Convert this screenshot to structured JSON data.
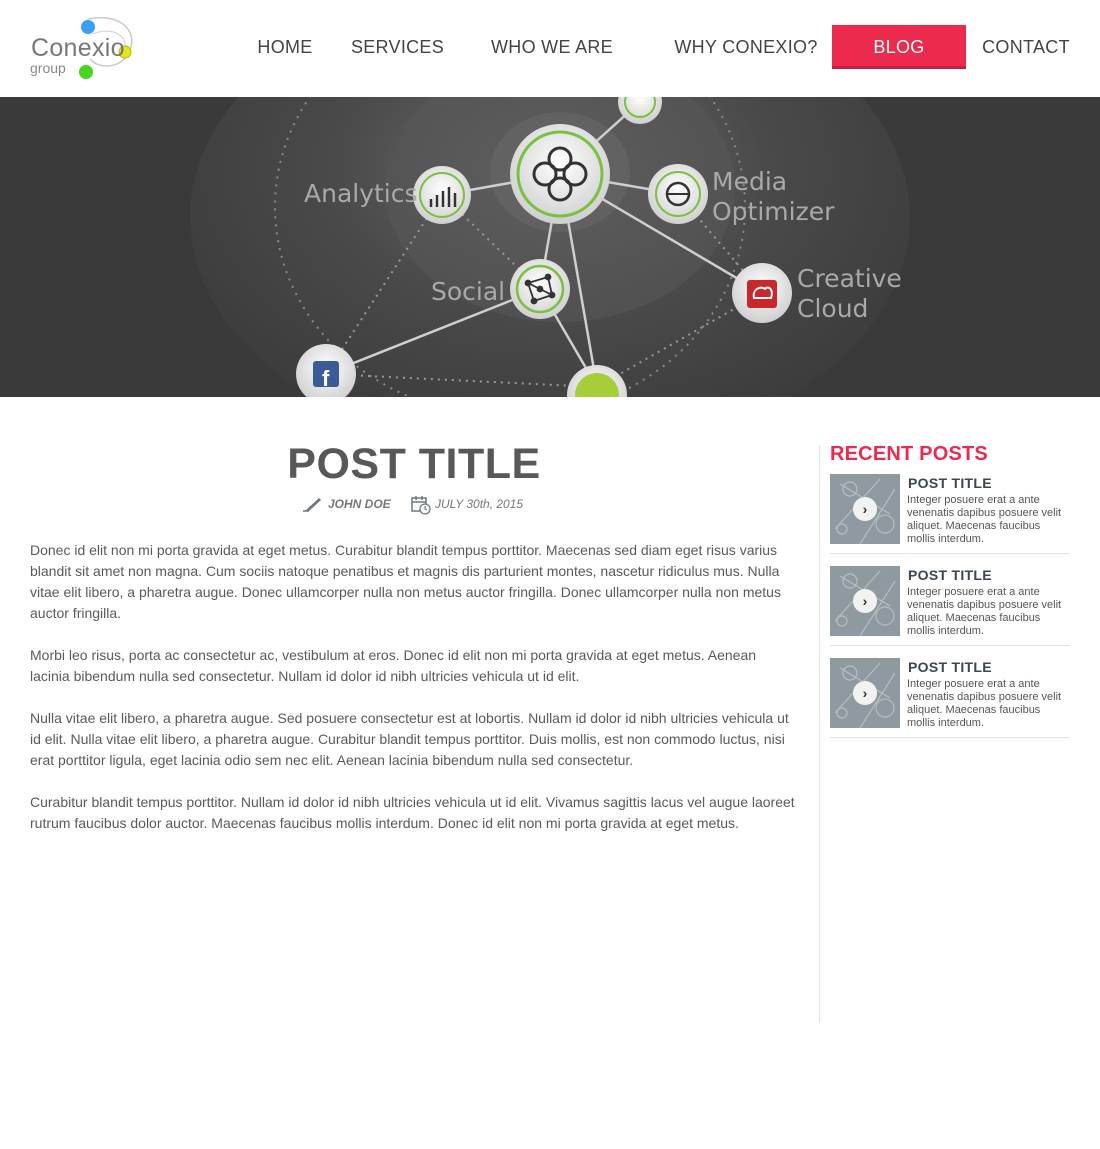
{
  "brand": {
    "name": "Conexio",
    "sub": "group"
  },
  "nav": {
    "items": [
      {
        "label": "HOME"
      },
      {
        "label": "SERVICES"
      },
      {
        "label": "WHO WE ARE"
      },
      {
        "label": "WHY CONEXIO?"
      },
      {
        "label": "BLOG",
        "active": true
      },
      {
        "label": "CONTACT"
      }
    ]
  },
  "hero": {
    "labels": {
      "analytics": "Analytics",
      "media1": "Media",
      "media2": "Optimizer",
      "social": "Social",
      "creative1": "Creative",
      "creative2": "Cloud"
    }
  },
  "post": {
    "title": "POST TITLE",
    "author": "JOHN DOE",
    "date": "JULY 30th, 2015",
    "paragraphs": [
      "Donec id elit non mi porta gravida at eget metus. Curabitur blandit tempus porttitor. Maecenas sed diam eget risus varius blandit sit amet non magna. Cum sociis natoque penatibus et magnis dis parturient montes, nascetur ridiculus mus. Nulla vitae elit libero, a pharetra augue. Donec ullamcorper nulla non metus auctor fringilla. Donec ullamcorper nulla non metus auctor fringilla.",
      "Morbi leo risus, porta ac consectetur ac, vestibulum at eros. Donec id elit non mi porta gravida at eget metus. Aenean lacinia bibendum nulla sed consectetur. Nullam id dolor id nibh ultricies vehicula ut id elit.",
      "Nulla vitae elit libero, a pharetra augue. Sed posuere consectetur est at lobortis. Nullam id dolor id nibh ultricies vehicula ut id elit. Nulla vitae elit libero, a pharetra augue. Curabitur blandit tempus porttitor. Duis mollis, est non commodo luctus, nisi erat porttitor ligula, eget lacinia odio sem nec elit. Aenean lacinia bibendum nulla sed consectetur.",
      "Curabitur blandit tempus porttitor. Nullam id dolor id nibh ultricies vehicula ut id elit. Vivamus sagittis lacus vel augue laoreet rutrum faucibus dolor auctor. Maecenas faucibus mollis interdum. Donec id elit non mi porta gravida at eget metus."
    ]
  },
  "sidebar": {
    "heading": "RECENT POSTS",
    "posts": [
      {
        "title": "POST TITLE",
        "excerpt": "Integer posuere erat a ante venenatis dapibus posuere velit aliquet. Maecenas faucibus mollis interdum."
      },
      {
        "title": "POST TITLE",
        "excerpt": "Integer posuere erat a ante venenatis dapibus posuere velit aliquet. Maecenas faucibus mollis interdum."
      },
      {
        "title": "POST TITLE",
        "excerpt": "Integer posuere erat a ante venenatis dapibus posuere velit aliquet. Maecenas faucibus mollis interdum."
      }
    ],
    "arrow_icon": "chevron-right-icon"
  },
  "colors": {
    "accent": "#ec2a4d",
    "heading": "#585858",
    "sidebar_title": "#3b4650"
  }
}
